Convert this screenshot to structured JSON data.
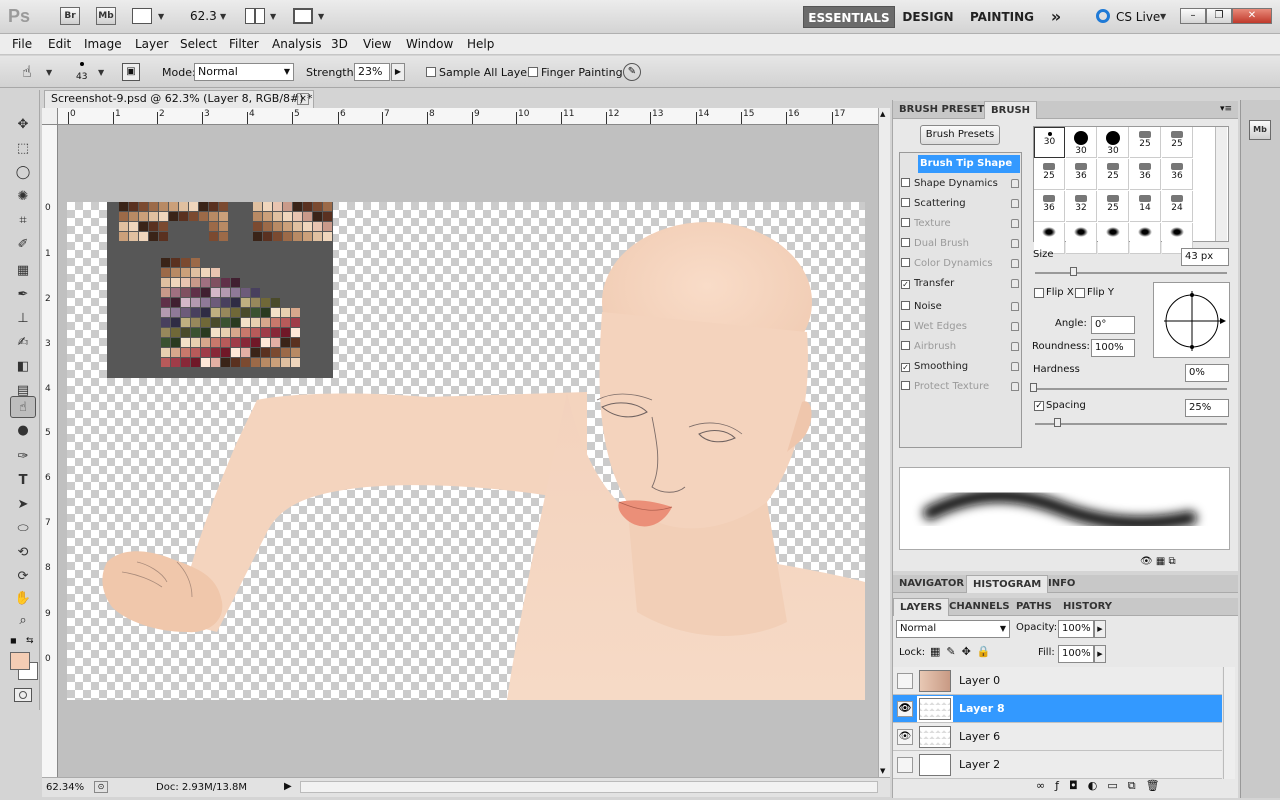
{
  "appbar": {
    "logo": "Ps",
    "bridge": "Br",
    "minibridge": "Mb",
    "zoom": "62.3",
    "workspaces": [
      "ESSENTIALS",
      "DESIGN",
      "PAINTING"
    ],
    "more": "»",
    "cslive": "CS Live"
  },
  "menu": [
    "File",
    "Edit",
    "Image",
    "Layer",
    "Select",
    "Filter",
    "Analysis",
    "3D",
    "View",
    "Window",
    "Help"
  ],
  "options": {
    "brush_size": "43",
    "mode_label": "Mode:",
    "mode_value": "Normal",
    "strength_label": "Strength:",
    "strength_value": "23%",
    "sample_all_layers": "Sample All Layers",
    "finger_painting": "Finger Painting"
  },
  "document": {
    "tab_title": "Screenshot-9.psd @ 62.3% (Layer 8, RGB/8#) *",
    "close": "×",
    "ruler_h": [
      "0",
      "1",
      "2",
      "3",
      "4",
      "5",
      "6",
      "7",
      "8",
      "9",
      "10",
      "11",
      "12",
      "13",
      "14",
      "15",
      "16",
      "17"
    ],
    "ruler_v": [
      "0",
      "1",
      "2",
      "3",
      "4",
      "5",
      "6",
      "7",
      "8",
      "9",
      "0"
    ]
  },
  "status": {
    "zoom": "62.34%",
    "doc": "Doc: 2.93M/13.8M"
  },
  "brush_panel": {
    "tabs": [
      "BRUSH PRESETS",
      "BRUSH"
    ],
    "presets_button": "Brush Presets",
    "options": [
      {
        "label": "Brush Tip Shape",
        "checked": false,
        "disabled": false,
        "selected": true
      },
      {
        "label": "Shape Dynamics",
        "checked": false,
        "disabled": false
      },
      {
        "label": "Scattering",
        "checked": false,
        "disabled": false
      },
      {
        "label": "Texture",
        "checked": false,
        "disabled": true
      },
      {
        "label": "Dual Brush",
        "checked": false,
        "disabled": true
      },
      {
        "label": "Color Dynamics",
        "checked": false,
        "disabled": true
      },
      {
        "label": "Transfer",
        "checked": true,
        "disabled": false
      },
      {
        "label": "Noise",
        "checked": false,
        "disabled": false
      },
      {
        "label": "Wet Edges",
        "checked": false,
        "disabled": true
      },
      {
        "label": "Airbrush",
        "checked": false,
        "disabled": true
      },
      {
        "label": "Smoothing",
        "checked": true,
        "disabled": false
      },
      {
        "label": "Protect Texture",
        "checked": false,
        "disabled": true
      }
    ],
    "tips": [
      "30",
      "30",
      "30",
      "25",
      "25",
      "25",
      "36",
      "25",
      "36",
      "36",
      "36",
      "32",
      "25",
      "14",
      "24",
      "",
      "",
      "",
      "",
      ""
    ],
    "size_label": "Size",
    "size_value": "43 px",
    "flipx": "Flip X",
    "flipy": "Flip Y",
    "angle_label": "Angle:",
    "angle_value": "0°",
    "roundness_label": "Roundness:",
    "roundness_value": "100%",
    "hardness_label": "Hardness",
    "hardness_value": "0%",
    "spacing_label": "Spacing",
    "spacing_value": "25%"
  },
  "nav_panel": {
    "tabs": [
      "NAVIGATOR",
      "HISTOGRAM",
      "INFO"
    ]
  },
  "layers_panel": {
    "tabs": [
      "LAYERS",
      "CHANNELS",
      "PATHS",
      "HISTORY"
    ],
    "blend_mode": "Normal",
    "opacity_label": "Opacity:",
    "opacity_value": "100%",
    "lock_label": "Lock:",
    "fill_label": "Fill:",
    "fill_value": "100%",
    "layers": [
      {
        "name": "Layer 0",
        "visible": false,
        "selected": false
      },
      {
        "name": "Layer 8",
        "visible": true,
        "selected": true
      },
      {
        "name": "Layer 6",
        "visible": true,
        "selected": false
      },
      {
        "name": "Layer 2",
        "visible": false,
        "selected": false
      }
    ]
  },
  "colors": {
    "foreground": "#f4cdb4",
    "background": "#ffffff",
    "skin": "#f5d5bf",
    "lips": "#eb8f78"
  }
}
